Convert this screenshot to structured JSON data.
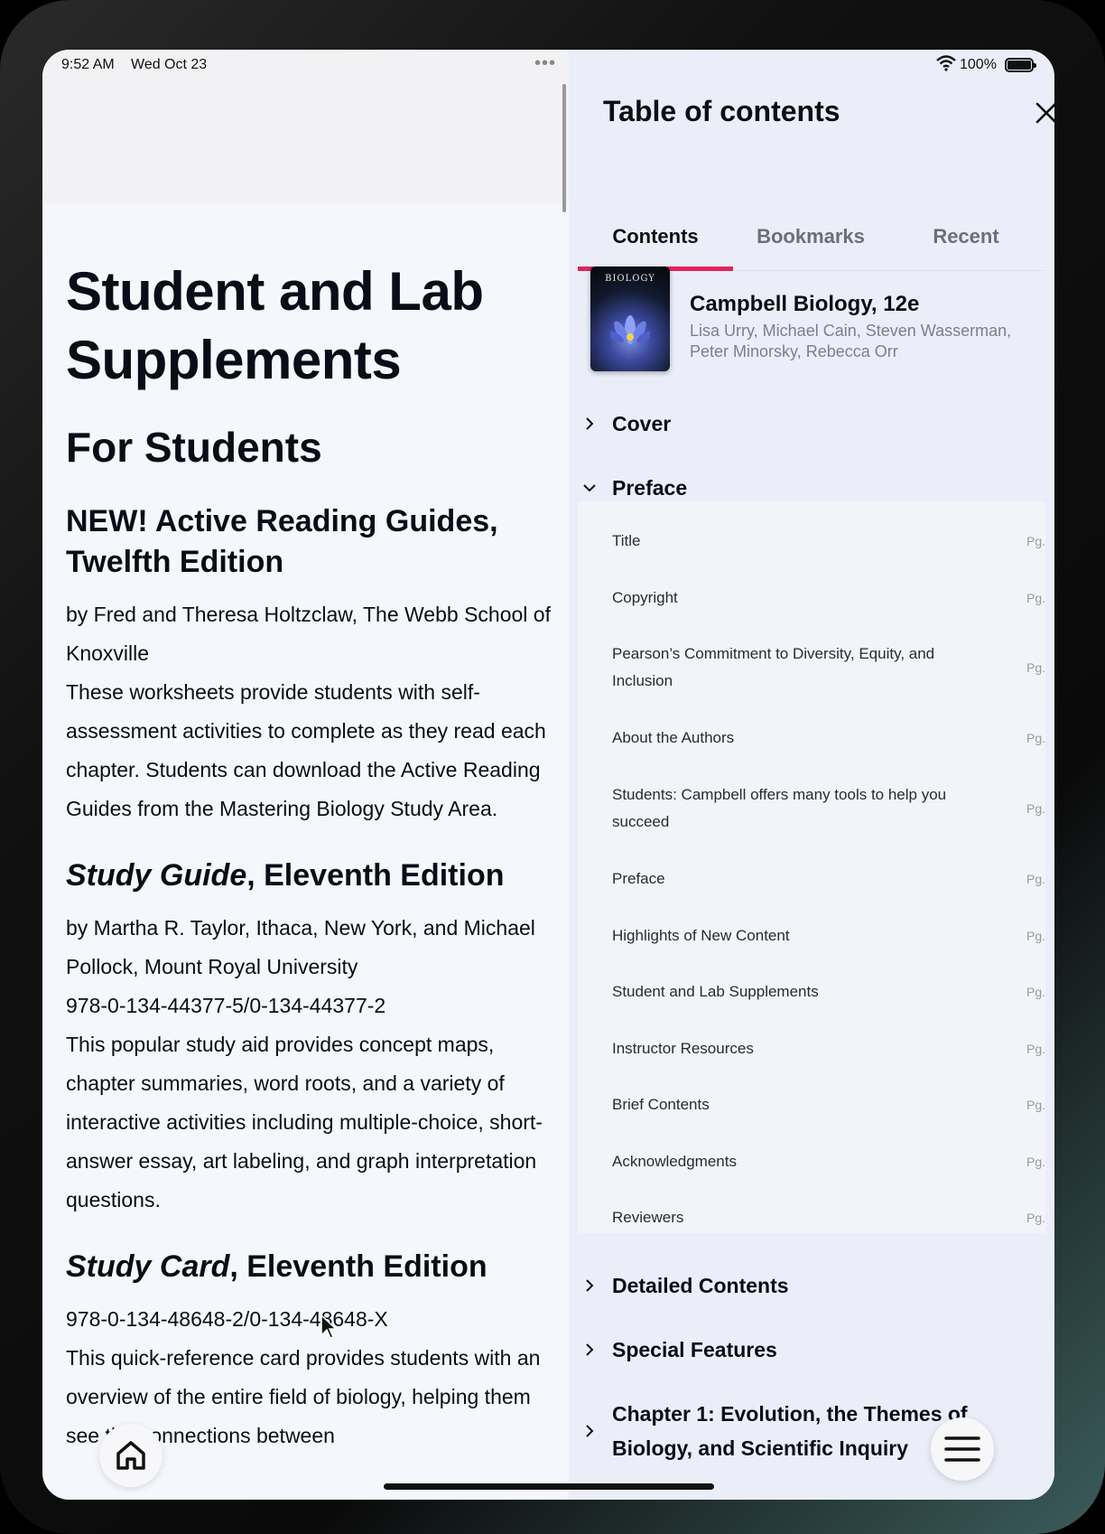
{
  "status_bar": {
    "time": "9:52 AM",
    "date": "Wed Oct 23",
    "battery": "100%"
  },
  "reader": {
    "heading": "Student and Lab Supplements",
    "subheading": "For Students",
    "entries": [
      {
        "title_italic": "NEW! Active Reading Guides,",
        "title_plain": "Twelfth Edition",
        "byline": "by Fred and Theresa Holtzclaw, The Webb School of Knoxville",
        "body": "These worksheets provide students with self-assessment activities to complete as they read each chapter. Students can download the Active Reading Guides from the Mastering Biology Study Area."
      },
      {
        "title_italic": "Study Guide",
        "title_plain": ", Eleventh Edition",
        "byline": "by Martha R. Taylor, Ithaca, New York, and Michael Pollock, Mount Royal University",
        "isbn": "978-0-134-44377-5/0-134-44377-2",
        "body": "This popular study aid provides concept maps, chapter summaries, word roots, and a variety of interactive activities including multiple-choice, short-answer essay, art labeling, and graph interpretation questions."
      },
      {
        "title_italic": "Study Card",
        "title_plain": ", Eleventh Edition",
        "isbn": "978-0-134-48648-2/0-134-48648-X",
        "body": "This quick-reference card provides students with an overview of the entire field of biology, helping them see the connections between"
      }
    ]
  },
  "toc": {
    "title": "Table of contents",
    "tabs": [
      "Contents",
      "Bookmarks",
      "Recent"
    ],
    "active_tab": "Contents",
    "book": {
      "cover_text": "BIOLOGY",
      "name": "Campbell Biology, 12e",
      "authors": "Lisa Urry, Michael Cain, Steven Wasserman, Peter Minorsky, Rebecca Orr"
    },
    "sections": {
      "cover": "Cover",
      "preface": "Preface",
      "detailed": "Detailed Contents",
      "special": "Special Features",
      "chapter1": "Chapter 1: Evolution, the Themes of Biology, and Scientific Inquiry"
    },
    "preface_items": [
      {
        "label": "Title",
        "pg": "Pg."
      },
      {
        "label": "Copyright",
        "pg": "Pg."
      },
      {
        "label": "Pearson’s Commitment to Diversity, Equity, and Inclusion",
        "pg": "Pg."
      },
      {
        "label": "About the Authors",
        "pg": "Pg."
      },
      {
        "label": "Students: Campbell offers many tools to help you succeed",
        "pg": "Pg."
      },
      {
        "label": "Preface",
        "pg": "Pg."
      },
      {
        "label": "Highlights of New Content",
        "pg": "Pg."
      },
      {
        "label": "Student and Lab Supplements",
        "pg": "Pg."
      },
      {
        "label": "Instructor Resources",
        "pg": "Pg."
      },
      {
        "label": "Brief Contents",
        "pg": "Pg."
      },
      {
        "label": "Acknowledgments",
        "pg": "Pg."
      },
      {
        "label": "Reviewers",
        "pg": "Pg."
      }
    ]
  },
  "colors": {
    "accent": "#e2245a",
    "toc_bg": "#ebeef8",
    "reader_bg": "#f4f7fc"
  },
  "icons": [
    "home-icon",
    "menu-icon",
    "close-icon",
    "chevron-right-icon",
    "chevron-down-icon",
    "wifi-icon",
    "battery-icon"
  ]
}
